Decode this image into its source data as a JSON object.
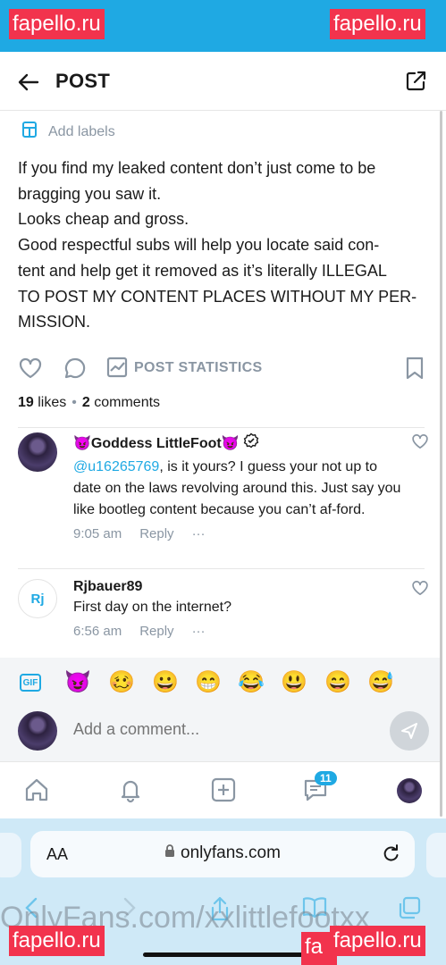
{
  "watermarks": {
    "brand": "fapello.ru",
    "brand_partial": "fa"
  },
  "header": {
    "title": "POST"
  },
  "labels": {
    "add_labels": "Add labels"
  },
  "post": {
    "lines": [
      "If you find my leaked content don’t just come to be",
      "bragging you saw it.",
      "Looks cheap and gross.",
      "Good respectful subs will help you locate said con-",
      "tent and help get it removed as it’s literally ILLEGAL",
      "TO POST MY CONTENT PLACES WITHOUT MY PER-",
      "MISSION."
    ],
    "stats_label": "POST STATISTICS",
    "likes_count": "19",
    "likes_label": "likes",
    "comments_count": "2",
    "comments_label": "comments"
  },
  "comments": [
    {
      "name": "😈Goddess LittleFoot😈",
      "mention": "@u16265769",
      "text": ", is it yours? I guess your not up to date on the laws revolving around this. Just say you like bootleg content because you can’t af-ford.",
      "time": "9:05 am",
      "reply": "Reply",
      "more": "···"
    },
    {
      "name": "Rjbauer89",
      "avatar_initials": "Rj",
      "text": "First day on the internet?",
      "time": "6:56 am",
      "reply": "Reply",
      "more": "···"
    }
  ],
  "emoji_bar": {
    "gif_label": "GIF",
    "emojis": [
      "😈",
      "🥴",
      "😀",
      "😁",
      "😂",
      "😃",
      "😄",
      "😅"
    ]
  },
  "add_comment": {
    "placeholder": "Add a comment..."
  },
  "bottom_nav": {
    "messages_badge": "11"
  },
  "browser": {
    "aa_label": "AA",
    "url": "onlyfans.com",
    "watermark_text": "OnlyFans.com/xxlittlefootxx"
  },
  "colors": {
    "accent": "#1fa9e3",
    "muted": "#8a96a3",
    "watermark_red": "#f2334d"
  }
}
